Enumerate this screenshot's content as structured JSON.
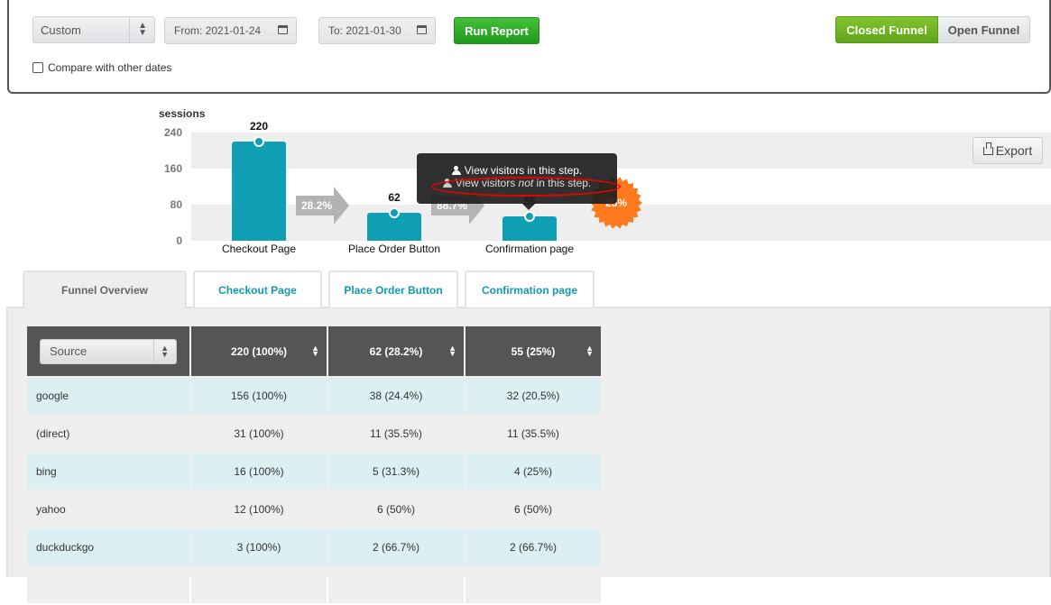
{
  "filters": {
    "period_select": "Custom",
    "from_label": "From:",
    "from_date": "2021-01-24",
    "to_label": "To:",
    "to_date": "2021-01-30",
    "run_report": "Run Report",
    "compare_label": "Compare with other dates",
    "compare_checked": false,
    "funnel_modes": [
      "Closed Funnel",
      "Open Funnel"
    ],
    "active_mode": "Closed Funnel"
  },
  "chart": {
    "export_label": "Export",
    "tooltip": {
      "line1": "View visitors in this step.",
      "line2_pre": "View visitors ",
      "line2_em": "not",
      "line2_post": " in this step."
    },
    "badge": "25%",
    "accent": "#10a0b5",
    "badge_color": "#ff7a1e"
  },
  "chart_data": {
    "type": "bar",
    "ylabel": "sessions",
    "ylim": [
      0,
      240
    ],
    "yticks": [
      0,
      80,
      160,
      240
    ],
    "categories": [
      "Checkout Page",
      "Place Order Button",
      "Confirmation page"
    ],
    "values": [
      220,
      62,
      55
    ],
    "value_labels": [
      "220",
      "62",
      "55"
    ],
    "conversion_labels": [
      "28.2%",
      "88.7%"
    ],
    "overall_conversion": "25%"
  },
  "tabs": [
    "Funnel Overview",
    "Checkout Page",
    "Place Order Button",
    "Confirmation page"
  ],
  "table": {
    "group_select": "Source",
    "headers": [
      "220 (100%)",
      "62 (28.2%)",
      "55 (25%)"
    ],
    "rows": [
      [
        "google",
        "156 (100%)",
        "38 (24.4%)",
        "32 (20.5%)"
      ],
      [
        "(direct)",
        "31 (100%)",
        "11 (35.5%)",
        "11 (35.5%)"
      ],
      [
        "bing",
        "16 (100%)",
        "5 (31.3%)",
        "4 (25%)"
      ],
      [
        "yahoo",
        "12 (100%)",
        "6 (50%)",
        "6 (50%)"
      ],
      [
        "duckduckgo",
        "3 (100%)",
        "2 (66.7%)",
        "2 (66.7%)"
      ]
    ]
  }
}
